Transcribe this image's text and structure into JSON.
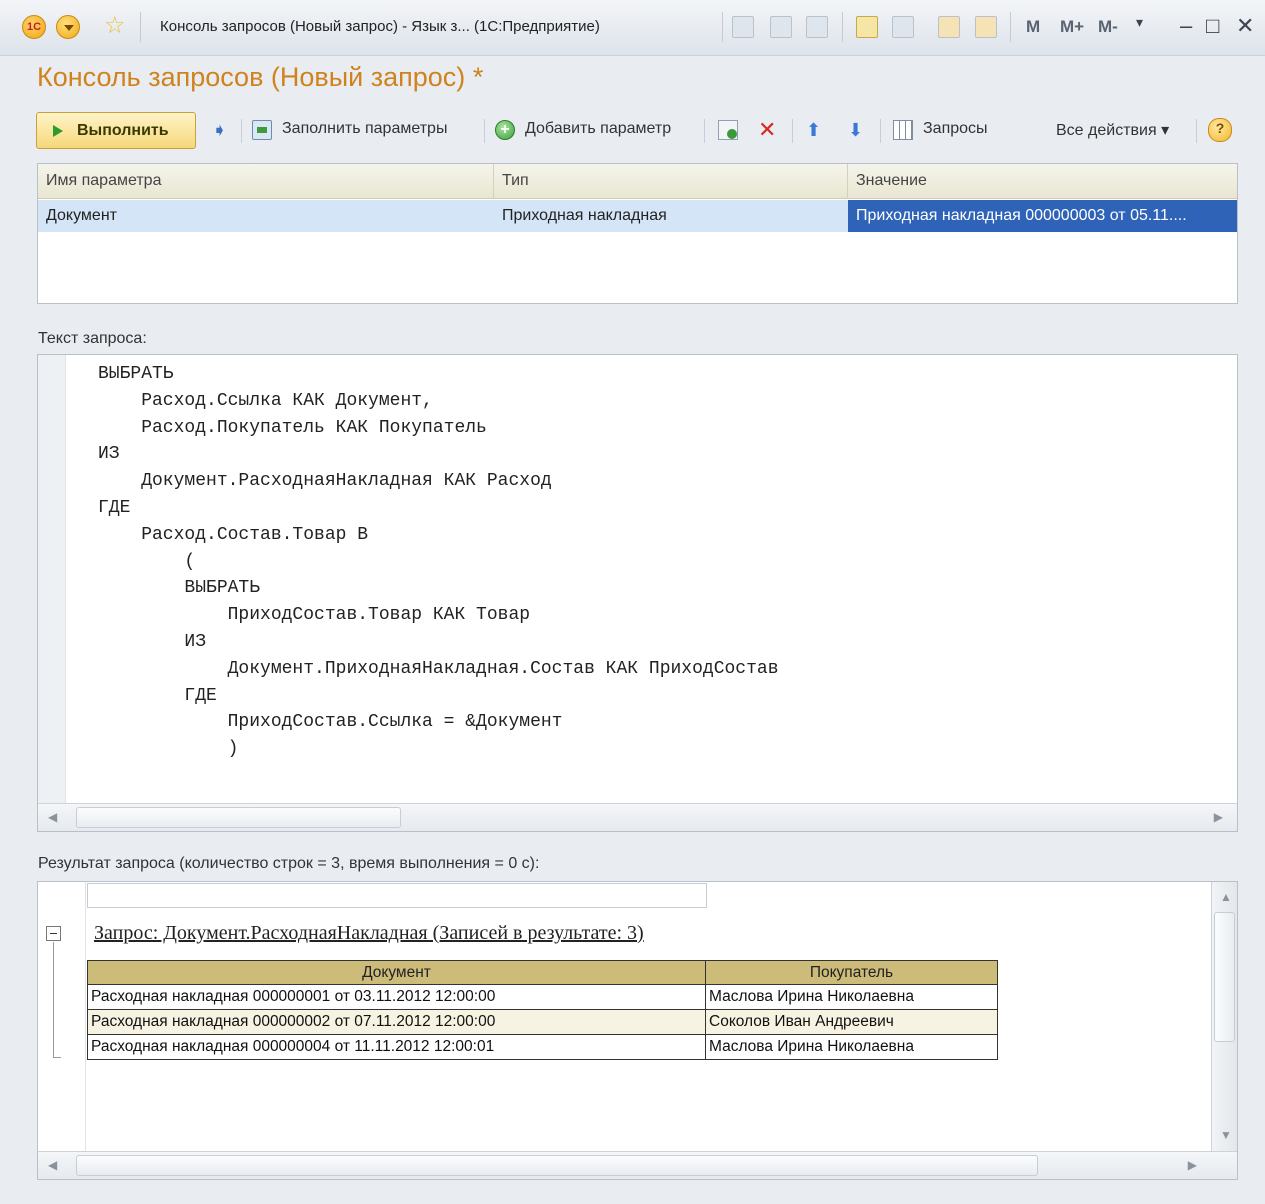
{
  "titlebar": {
    "logo": "1С",
    "title": "Консоль запросов (Новый запрос) - Язык з...  (1С:Предприятие)",
    "m": "M",
    "m_plus": "M+",
    "m_minus": "M-",
    "minimize": "–",
    "maximize": "□",
    "close": "✕"
  },
  "window": {
    "title": "Консоль запросов (Новый запрос)",
    "modified_mark": "*"
  },
  "toolbar": {
    "run_label": "Выполнить",
    "fill_params_label": "Заполнить параметры",
    "add_param_label": "Добавить параметр",
    "queries_label": "Запросы",
    "all_actions_label": "Все действия ▾"
  },
  "params": {
    "columns": [
      "Имя параметра",
      "Тип",
      "Значение"
    ],
    "rows": [
      {
        "name": "Документ",
        "type": "Приходная накладная",
        "value": "Приходная накладная 000000003 от 05.11...."
      }
    ]
  },
  "query": {
    "label": "Текст запроса:",
    "text": "ВЫБРАТЬ\n    Расход.Ссылка КАК Документ,\n    Расход.Покупатель КАК Покупатель\nИЗ\n    Документ.РасходнаяНакладная КАК Расход\nГДЕ\n    Расход.Состав.Товар В\n        (\n        ВЫБРАТЬ\n            ПриходСостав.Товар КАК Товар\n        ИЗ\n            Документ.ПриходнаяНакладная.Состав КАК ПриходСостав\n        ГДЕ\n            ПриходСостав.Ссылка = &Документ\n            )"
  },
  "result": {
    "label": "Результат запроса (количество строк = 3, время выполнения = 0 с):",
    "heading": "Запрос: Документ.РасходнаяНакладная (Записей в результате: 3)",
    "columns": [
      "Документ",
      "Покупатель"
    ],
    "rows": [
      [
        "Расходная накладная 000000001 от 03.11.2012 12:00:00",
        "Маслова Ирина Николаевна"
      ],
      [
        "Расходная накладная 000000002 от 07.11.2012 12:00:00",
        "Соколов Иван Андреевич"
      ],
      [
        "Расходная накладная 000000004 от 11.11.2012 12:00:01",
        "Маслова Ирина Николаевна"
      ]
    ]
  }
}
